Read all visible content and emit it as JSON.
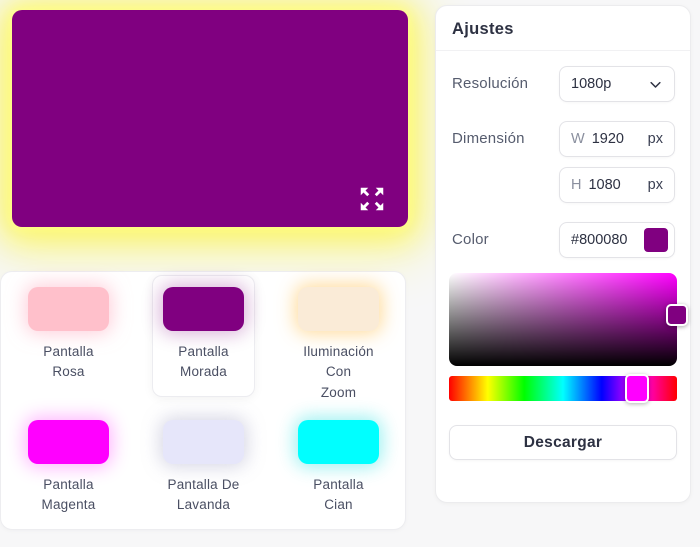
{
  "page": {
    "background": "#f7f7f8"
  },
  "preview": {
    "color": "#800080",
    "glow_color": "#FFFF00"
  },
  "swatch_panel": {
    "items": [
      {
        "label": "Pantalla\nRosa",
        "color": "#FFC0CB",
        "glow": "rgba(255,170,190,0.55)",
        "selected": false
      },
      {
        "label": "Pantalla\nMorada",
        "color": "#800080",
        "glow": "rgba(128,0,128,0.30)",
        "selected": true
      },
      {
        "label": "Iluminación\nCon\nZoom",
        "color": "#FAEBD7",
        "glow": "rgba(255,214,140,0.85)",
        "selected": false
      },
      {
        "label": "Pantalla\nMagenta",
        "color": "#FF00FF",
        "glow": "rgba(255,0,255,0.30)",
        "selected": false
      },
      {
        "label": "Pantalla De\nLavanda",
        "color": "#E6E6FA",
        "glow": "rgba(140,140,180,0.35)",
        "selected": false
      },
      {
        "label": "Pantalla\nCian",
        "color": "#00FFFF",
        "glow": "rgba(0,220,220,0.40)",
        "selected": false
      }
    ]
  },
  "settings": {
    "title": "Ajustes",
    "resolution": {
      "label": "Resolución",
      "value": "1080p"
    },
    "dimension": {
      "label": "Dimensión",
      "width": {
        "prefix": "W",
        "value": "1920",
        "unit": "px"
      },
      "height": {
        "prefix": "H",
        "value": "1080",
        "unit": "px"
      }
    },
    "color": {
      "label": "Color",
      "value": "#800080"
    },
    "picker": {
      "hue_color": "#FF00FF",
      "sv_handle_color": "#800080",
      "hue_handle_color": "#FF00FF"
    },
    "download_label": "Descargar"
  }
}
